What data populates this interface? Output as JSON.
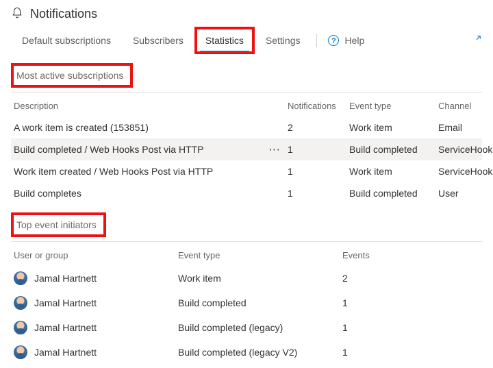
{
  "header": {
    "title": "Notifications"
  },
  "tabs": {
    "default": "Default subscriptions",
    "subscribers": "Subscribers",
    "statistics": "Statistics",
    "settings": "Settings"
  },
  "help": {
    "label": "Help",
    "icon_char": "?"
  },
  "section1": {
    "title": "Most active subscriptions",
    "headers": {
      "description": "Description",
      "notifications": "Notifications",
      "eventType": "Event type",
      "channel": "Channel"
    },
    "rows": [
      {
        "description": "A work item is created (153851)",
        "notifications": "2",
        "eventType": "Work item",
        "channel": "Email"
      },
      {
        "description": "Build completed / Web Hooks Post via HTTP",
        "notifications": "1",
        "eventType": "Build completed",
        "channel": "ServiceHooks"
      },
      {
        "description": "Work item created / Web Hooks Post via HTTP",
        "notifications": "1",
        "eventType": "Work item",
        "channel": "ServiceHooks"
      },
      {
        "description": "Build completes",
        "notifications": "1",
        "eventType": "Build completed",
        "channel": "User"
      }
    ]
  },
  "section2": {
    "title": "Top event initiators",
    "headers": {
      "userOrGroup": "User or group",
      "eventType": "Event type",
      "events": "Events"
    },
    "rows": [
      {
        "user": "Jamal Hartnett",
        "eventType": "Work item",
        "events": "2"
      },
      {
        "user": "Jamal Hartnett",
        "eventType": "Build completed",
        "events": "1"
      },
      {
        "user": "Jamal Hartnett",
        "eventType": "Build completed (legacy)",
        "events": "1"
      },
      {
        "user": "Jamal Hartnett",
        "eventType": "Build completed (legacy V2)",
        "events": "1"
      }
    ]
  },
  "more_label": "···"
}
